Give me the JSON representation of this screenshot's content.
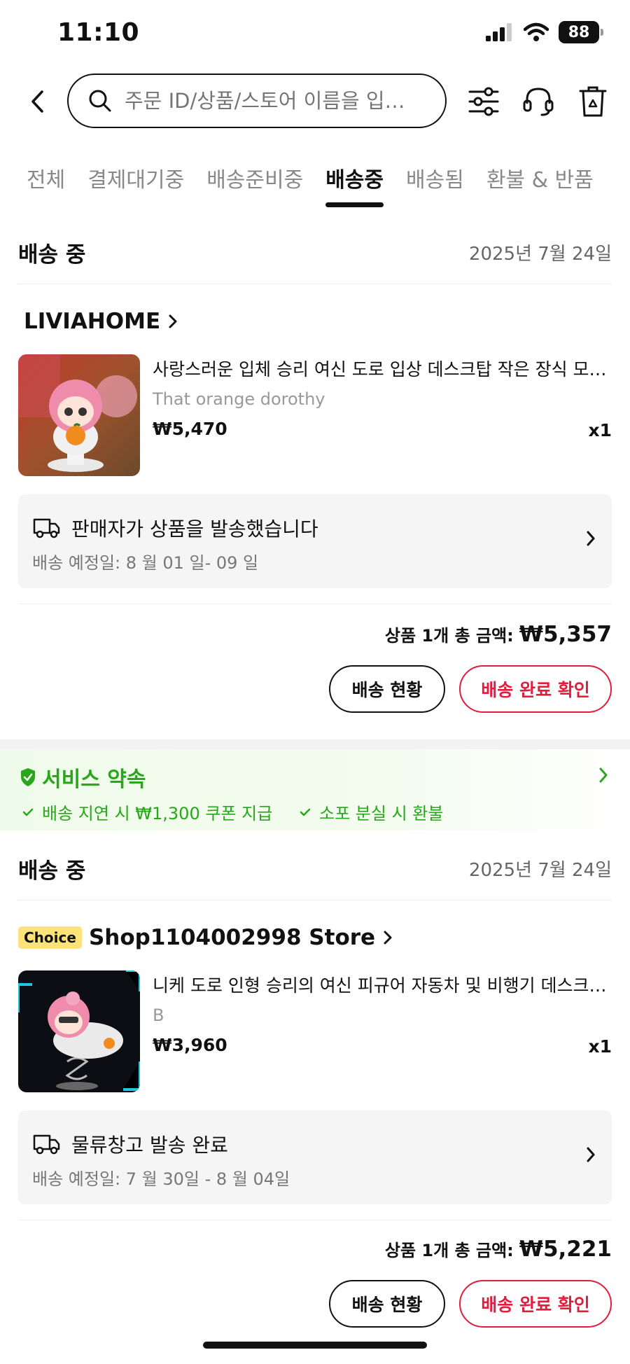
{
  "status_bar": {
    "time": "11:10",
    "battery": "88"
  },
  "search": {
    "placeholder": "주문 ID/상품/스토어 이름을 입…"
  },
  "tabs": [
    {
      "label": "전체"
    },
    {
      "label": "결제대기중"
    },
    {
      "label": "배송준비중"
    },
    {
      "label": "배송중"
    },
    {
      "label": "배송됨"
    },
    {
      "label": "환불 & 반품"
    }
  ],
  "orders": [
    {
      "status": "배송 중",
      "date": "2025년 7월 24일",
      "store": "LIVIAHOME",
      "product_title": "사랑스러운 입체 승리 여신 도로 입상 데스크탑 작은 장식 모델...",
      "variant": "That orange dorothy",
      "price": "₩5,470",
      "qty": "x1",
      "shipping_title": "판매자가 상품을 발송했습니다",
      "shipping_eta": "배송 예정일: 8 월 01 일- 09 일",
      "total_label": "상품 1개 총 금액:",
      "total_amount": "₩5,357",
      "track_label": "배송 현황",
      "confirm_label": "배송 완료 확인"
    },
    {
      "status": "배송 중",
      "date": "2025년 7월 24일",
      "badge": "Choice",
      "store": "Shop1104002998 Store",
      "product_title": "니케 도로 인형 승리의 여신 피규어 자동차 및 비행기 데스크탑...",
      "variant": "B",
      "price": "₩3,960",
      "qty": "x1",
      "shipping_title": "물류창고 발송 완료",
      "shipping_eta": "배송 예정일: 7 월 30일 - 8 월 04일",
      "total_label": "상품 1개 총 금액:",
      "total_amount": "₩5,221",
      "track_label": "배송 현황",
      "confirm_label": "배송 완료 확인"
    }
  ],
  "promise": {
    "title": "서비스 약속",
    "items": [
      "배송 지연 시 ₩1,300 쿠폰 지급",
      "소포 분실 시 환불"
    ]
  },
  "colors": {
    "accent_red": "#e21c3c",
    "promise_green": "#27a719",
    "choice_yellow": "#ffe27a"
  }
}
